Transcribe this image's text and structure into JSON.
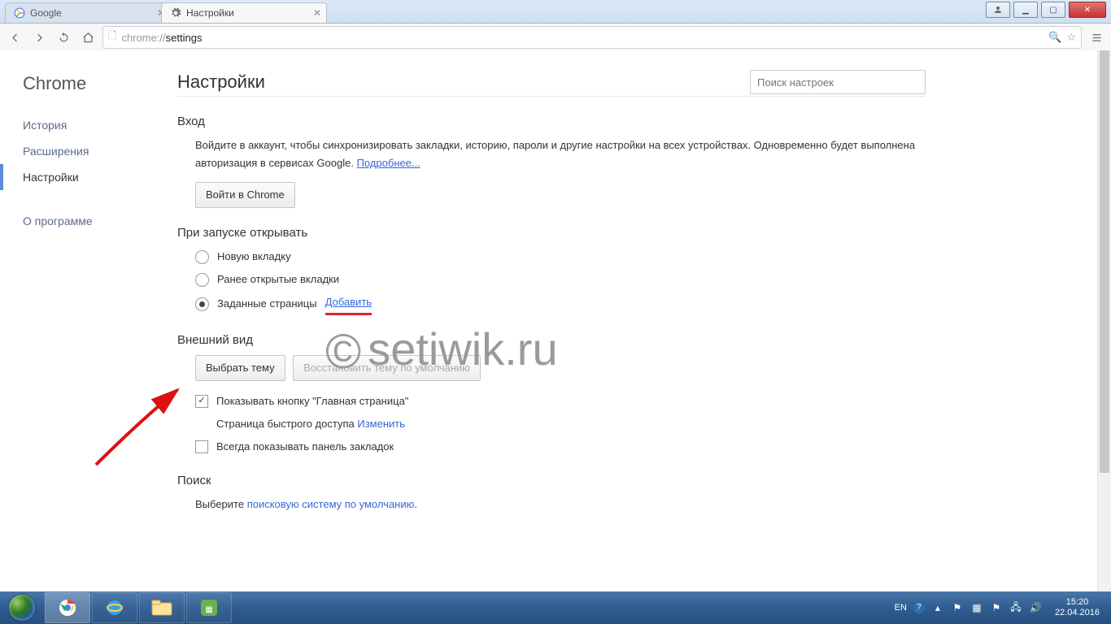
{
  "window": {
    "tabs": [
      {
        "label": "Google",
        "active": false
      },
      {
        "label": "Настройки",
        "active": true
      }
    ]
  },
  "toolbar": {
    "url_scheme": "chrome://",
    "url_path": "settings"
  },
  "sidebar": {
    "brand": "Chrome",
    "items": [
      "История",
      "Расширения",
      "Настройки"
    ],
    "active_index": 2,
    "about": "О программе"
  },
  "settings": {
    "title": "Настройки",
    "search_placeholder": "Поиск настроек",
    "signin": {
      "heading": "Вход",
      "text_before_link": "Войдите в аккаунт, чтобы синхронизировать закладки, историю, пароли и другие настройки на всех устройствах. Одновременно будет выполнена авторизация в сервисах Google. ",
      "more_link": "Подробнее...",
      "button": "Войти в Chrome"
    },
    "startup": {
      "heading": "При запуске открывать",
      "options": [
        {
          "label": "Новую вкладку",
          "selected": false
        },
        {
          "label": "Ранее открытые вкладки",
          "selected": false
        },
        {
          "label_before": "Заданные страницы ",
          "link": "Добавить",
          "selected": true
        }
      ]
    },
    "appearance": {
      "heading": "Внешний вид",
      "choose_theme": "Выбрать тему",
      "reset_theme": "Восстановить тему по умолчанию",
      "show_home_label": "Показывать кнопку \"Главная страница\"",
      "quick_access_text": "Страница быстрого доступа ",
      "quick_access_link": "Изменить",
      "always_show_bookmarks": "Всегда показывать панель закладок"
    },
    "search": {
      "heading": "Поиск",
      "text_before": "Выберите ",
      "link": "поисковую систему по умолчанию",
      "text_after": "."
    }
  },
  "watermark_text": "setiwik.ru",
  "taskbar": {
    "lang": "EN",
    "time": "15:20",
    "date": "22.04.2016"
  }
}
